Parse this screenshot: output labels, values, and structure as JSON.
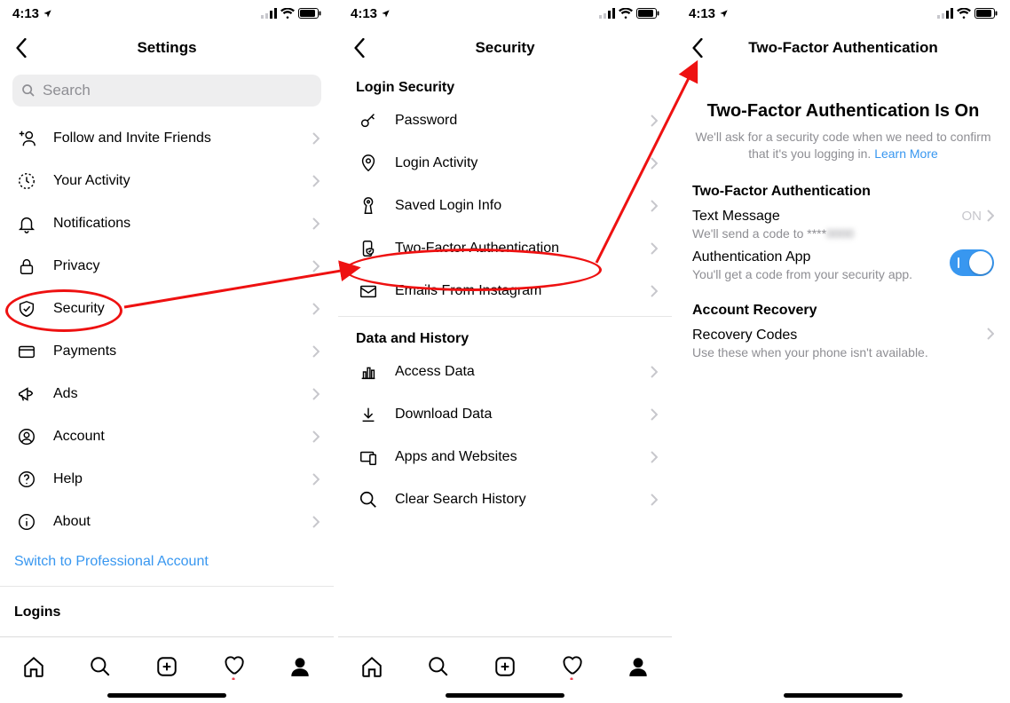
{
  "status": {
    "time": "4:13"
  },
  "phone1": {
    "title": "Settings",
    "search_placeholder": "Search",
    "items": [
      {
        "icon": "add_user",
        "label": "Follow and Invite Friends"
      },
      {
        "icon": "activity",
        "label": "Your Activity"
      },
      {
        "icon": "bell",
        "label": "Notifications"
      },
      {
        "icon": "lock",
        "label": "Privacy"
      },
      {
        "icon": "shield",
        "label": "Security"
      },
      {
        "icon": "card",
        "label": "Payments"
      },
      {
        "icon": "ads",
        "label": "Ads"
      },
      {
        "icon": "account",
        "label": "Account"
      },
      {
        "icon": "help",
        "label": "Help"
      },
      {
        "icon": "info",
        "label": "About"
      }
    ],
    "switch_link": "Switch to Professional Account",
    "logins_heading": "Logins"
  },
  "phone2": {
    "title": "Security",
    "section1": "Login Security",
    "items1": [
      {
        "icon": "key",
        "label": "Password"
      },
      {
        "icon": "pin",
        "label": "Login Activity"
      },
      {
        "icon": "keyhole",
        "label": "Saved Login Info"
      },
      {
        "icon": "twofa",
        "label": "Two-Factor Authentication"
      },
      {
        "icon": "mail",
        "label": "Emails From Instagram"
      }
    ],
    "section2": "Data and History",
    "items2": [
      {
        "icon": "bars",
        "label": "Access Data"
      },
      {
        "icon": "download",
        "label": "Download Data"
      },
      {
        "icon": "apps",
        "label": "Apps and Websites"
      },
      {
        "icon": "mag",
        "label": "Clear Search History"
      }
    ]
  },
  "phone3": {
    "title": "Two-Factor Authentication",
    "big_title": "Two-Factor Authentication Is On",
    "subtitle_a": "We'll ask for a security code when we need to confirm that it's you logging in. ",
    "subtitle_link": "Learn More",
    "section1": "Two-Factor Authentication",
    "text_msg_label": "Text Message",
    "text_msg_desc_prefix": "We'll send a code to ****",
    "text_msg_desc_hidden": "0000",
    "text_msg_status": "ON",
    "auth_app_label": "Authentication App",
    "auth_app_desc": "You'll get a code from your security app.",
    "section2": "Account Recovery",
    "recovery_label": "Recovery Codes",
    "recovery_desc": "Use these when your phone isn't available."
  }
}
